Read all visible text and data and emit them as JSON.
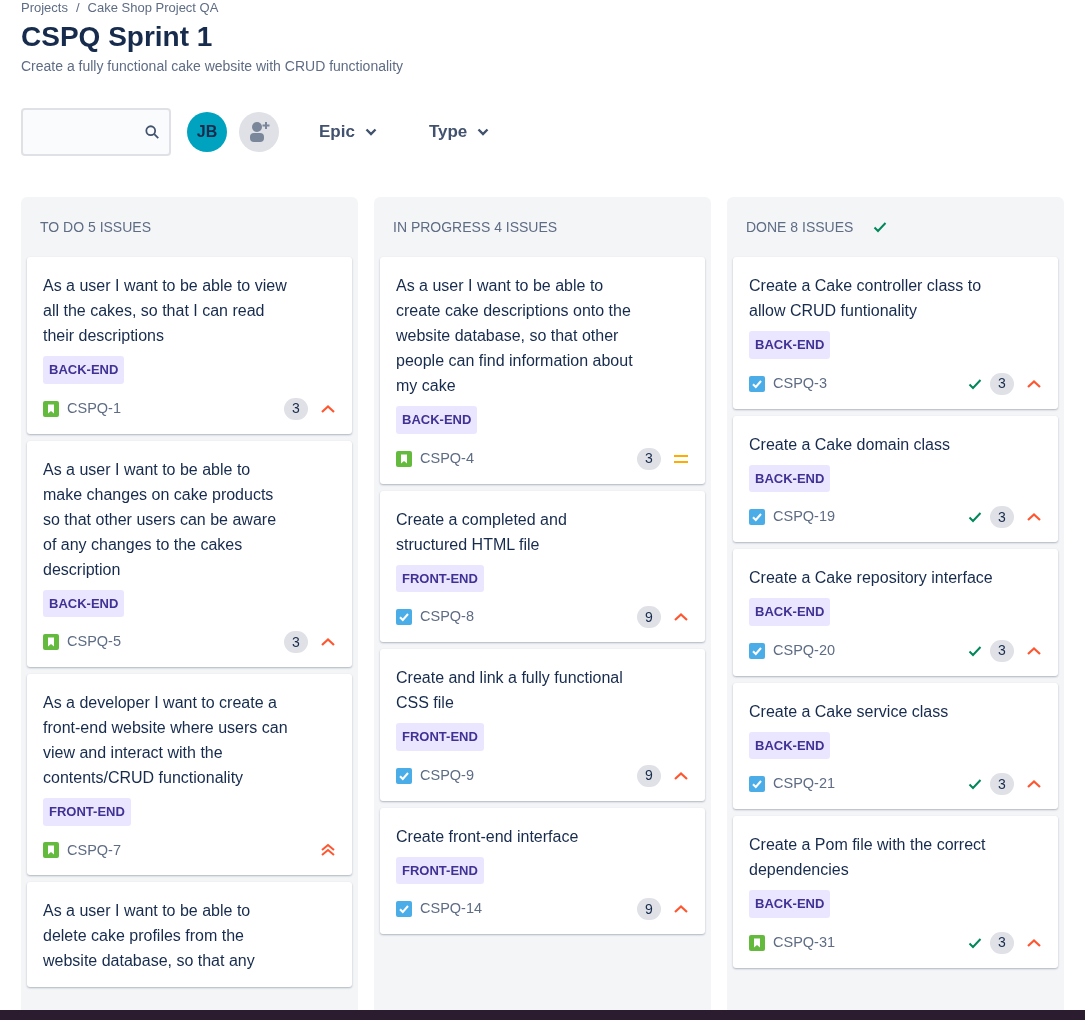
{
  "breadcrumbs": [
    "Projects",
    "Cake Shop Project QA"
  ],
  "breadcrumb_separator": "/",
  "board": {
    "title": "CSPQ Sprint 1",
    "goal": "Create a fully functional cake website with CRUD functionality"
  },
  "toolbar": {
    "avatar": "JB",
    "filters": [
      "Epic",
      "Type"
    ]
  },
  "columns": [
    {
      "title": "TO DO 5 ISSUES",
      "done": false,
      "cards": [
        {
          "summary": "As a user I want to be able to view all the cakes, so that I can read their descriptions",
          "label": "BACK-END",
          "kind": "story",
          "key": "CSPQ-1",
          "done": false,
          "points": "3",
          "priority": {
            "kind": "high"
          }
        },
        {
          "summary": "As a user I want to be able to make changes on cake products so that other users can be aware of any changes to the cakes description",
          "label": "BACK-END",
          "kind": "story",
          "key": "CSPQ-5",
          "done": false,
          "points": "3",
          "priority": {
            "kind": "high"
          }
        },
        {
          "summary": "As a developer I want to create a front-end website where users can view and interact with the contents/CRUD functionality",
          "label": "FRONT-END",
          "kind": "story",
          "key": "CSPQ-7",
          "done": false,
          "priority": {
            "kind": "highest"
          }
        },
        {
          "summary": "As a user I want to be able to delete cake profiles from the website database, so that any"
        }
      ]
    },
    {
      "title": "IN PROGRESS 4 ISSUES",
      "done": false,
      "cards": [
        {
          "summary": "As a user I want to be able to create cake descriptions onto the website database, so that other people can find information about my cake",
          "label": "BACK-END",
          "kind": "story",
          "key": "CSPQ-4",
          "done": false,
          "points": "3",
          "priority": {
            "kind": "medium"
          }
        },
        {
          "summary": "Create a completed and structured HTML file",
          "label": "FRONT-END",
          "kind": "task",
          "key": "CSPQ-8",
          "done": false,
          "points": "9",
          "priority": {
            "kind": "high"
          }
        },
        {
          "summary": "Create and link a fully functional CSS file",
          "label": "FRONT-END",
          "kind": "task",
          "key": "CSPQ-9",
          "done": false,
          "points": "9",
          "priority": {
            "kind": "high"
          }
        },
        {
          "summary": "Create front-end interface",
          "label": "FRONT-END",
          "kind": "task",
          "key": "CSPQ-14",
          "done": false,
          "points": "9",
          "priority": {
            "kind": "high"
          }
        }
      ]
    },
    {
      "title": "DONE 8 ISSUES",
      "done": true,
      "cards": [
        {
          "summary": "Create a Cake controller class to allow CRUD funtionality",
          "label": "BACK-END",
          "kind": "task",
          "key": "CSPQ-3",
          "done": true,
          "points": "3",
          "priority": {
            "kind": "high"
          }
        },
        {
          "summary": "Create a Cake domain class",
          "label": "BACK-END",
          "kind": "task",
          "key": "CSPQ-19",
          "done": true,
          "points": "3",
          "priority": {
            "kind": "high"
          }
        },
        {
          "summary": "Create a Cake repository interface",
          "label": "BACK-END",
          "kind": "task",
          "key": "CSPQ-20",
          "done": true,
          "points": "3",
          "priority": {
            "kind": "high"
          }
        },
        {
          "summary": "Create a Cake service class",
          "label": "BACK-END",
          "kind": "task",
          "key": "CSPQ-21",
          "done": true,
          "points": "3",
          "priority": {
            "kind": "high"
          }
        },
        {
          "summary": "Create a Pom file with the correct dependencies",
          "label": "BACK-END",
          "kind": "story",
          "key": "CSPQ-31",
          "done": true,
          "points": "3",
          "priority": {
            "kind": "high"
          }
        }
      ]
    }
  ]
}
